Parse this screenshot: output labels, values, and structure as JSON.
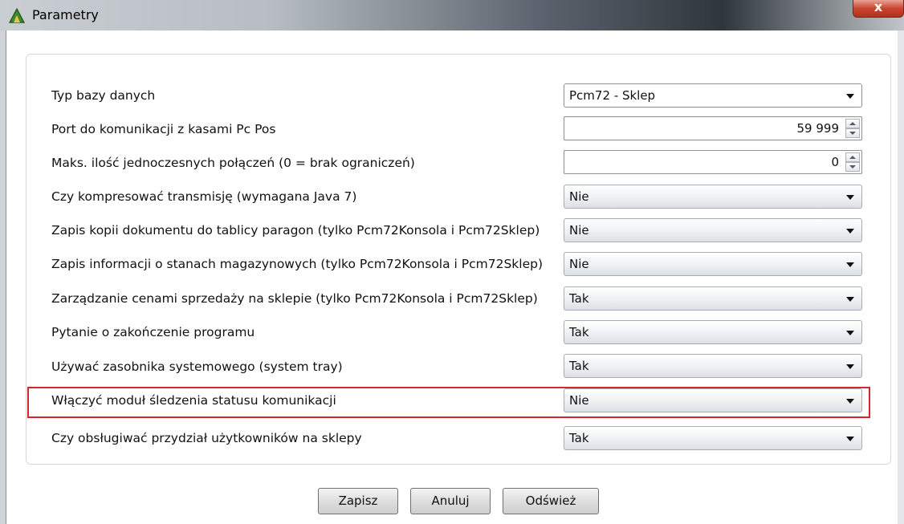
{
  "window": {
    "title": "Parametry",
    "close_label": "x"
  },
  "form": {
    "rows": [
      {
        "label": "Typ bazy danych",
        "control": "combo",
        "value": "Pcm72 - Sklep"
      },
      {
        "label": "Port do komunikacji z kasami Pc Pos",
        "control": "spinner",
        "value": "59 999"
      },
      {
        "label": "Maks. ilość jednoczesnych połączeń (0 = brak ograniczeń)",
        "control": "spinner",
        "value": "0"
      },
      {
        "label": "Czy kompresować transmisję (wymagana Java 7)",
        "control": "combo",
        "value": "Nie"
      },
      {
        "label": "Zapis kopii dokumentu do tablicy paragon (tylko Pcm72Konsola i Pcm72Sklep)",
        "control": "combo",
        "value": "Nie"
      },
      {
        "label": "Zapis informacji o stanach magazynowych (tylko Pcm72Konsola i Pcm72Sklep)",
        "control": "combo",
        "value": "Nie"
      },
      {
        "label": "Zarządzanie cenami sprzedaży na sklepie (tylko Pcm72Konsola i Pcm72Sklep)",
        "control": "combo",
        "value": "Tak"
      },
      {
        "label": "Pytanie o zakończenie programu",
        "control": "combo",
        "value": "Tak"
      },
      {
        "label": "Używać zasobnika systemowego (system tray)",
        "control": "combo",
        "value": "Tak"
      },
      {
        "label": "Włączyć moduł śledzenia statusu komunikacji",
        "control": "combo",
        "value": "Nie",
        "highlighted": true
      },
      {
        "label": "Czy obsługiwać przydział użytkowników na sklepy",
        "control": "combo",
        "value": "Tak"
      }
    ]
  },
  "buttons": {
    "save": "Zapisz",
    "cancel": "Anuluj",
    "refresh": "Odśwież"
  },
  "colors": {
    "highlight_border": "#d9242f"
  }
}
